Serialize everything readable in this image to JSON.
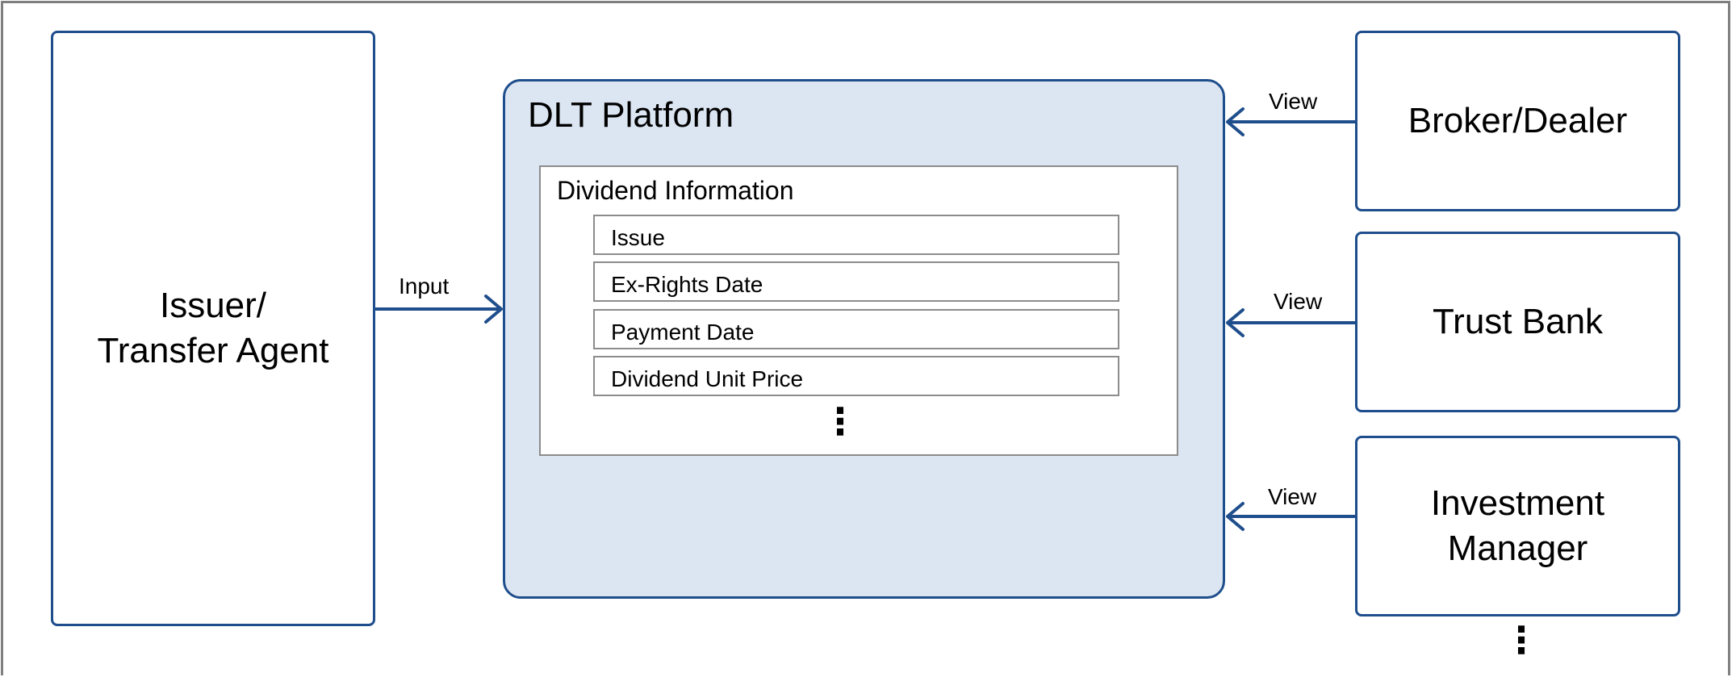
{
  "issuer": {
    "line1": "Issuer/",
    "line2": "Transfer Agent"
  },
  "input_label": "Input",
  "platform": {
    "title": "DLT Platform",
    "info_title": "Dividend Information",
    "fields": [
      "Issue",
      "Ex-Rights Date",
      "Payment Date",
      "Dividend Unit Price"
    ],
    "more": "⋮"
  },
  "participants": [
    {
      "label": "Broker/Dealer",
      "arrow_label": "View"
    },
    {
      "label": "Trust Bank",
      "arrow_label": "View"
    },
    {
      "label": "Investment Manager",
      "arrow_label": "View"
    }
  ],
  "participants_more": "⋮",
  "colors": {
    "accent": "#1f4e8c",
    "platform_fill": "#dce6f2",
    "border_gray": "#8c8c8c"
  }
}
